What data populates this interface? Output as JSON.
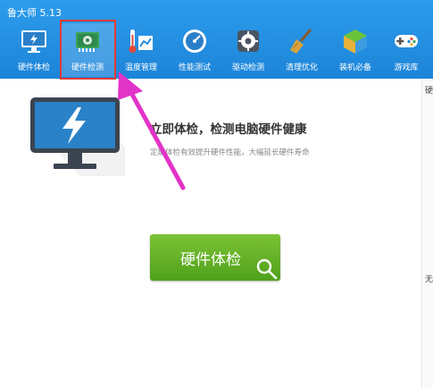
{
  "app": {
    "title": "鲁大师 5.13"
  },
  "tabs": [
    {
      "id": "hardware-check",
      "label": "硬件体检",
      "icon": "monitor-bolt-icon"
    },
    {
      "id": "hardware-detect",
      "label": "硬件检测",
      "icon": "circuit-board-icon",
      "selected": true
    },
    {
      "id": "temperature",
      "label": "温度管理",
      "icon": "thermometer-chart-icon"
    },
    {
      "id": "performance",
      "label": "性能测试",
      "icon": "speedometer-icon"
    },
    {
      "id": "driver",
      "label": "驱动检测",
      "icon": "gear-box-icon"
    },
    {
      "id": "cleanup",
      "label": "清理优化",
      "icon": "broom-icon"
    },
    {
      "id": "essentials",
      "label": "装机必备",
      "icon": "cube-box-icon"
    },
    {
      "id": "games",
      "label": "游戏库",
      "icon": "gamepad-icon"
    }
  ],
  "main": {
    "headline": "立即体检，检测电脑硬件健康",
    "subline": "定期体检有效提升硬件性能，大幅延长硬件寿命",
    "scan_button_label": "硬件体检"
  },
  "right_panel": {
    "top_glyph": "硬",
    "bottom_glyph": "无"
  },
  "colors": {
    "header_blue": "#1c84d8",
    "button_green": "#5aac22",
    "annotation_red": "#e53935",
    "annotation_arrow": "#e233c8"
  }
}
